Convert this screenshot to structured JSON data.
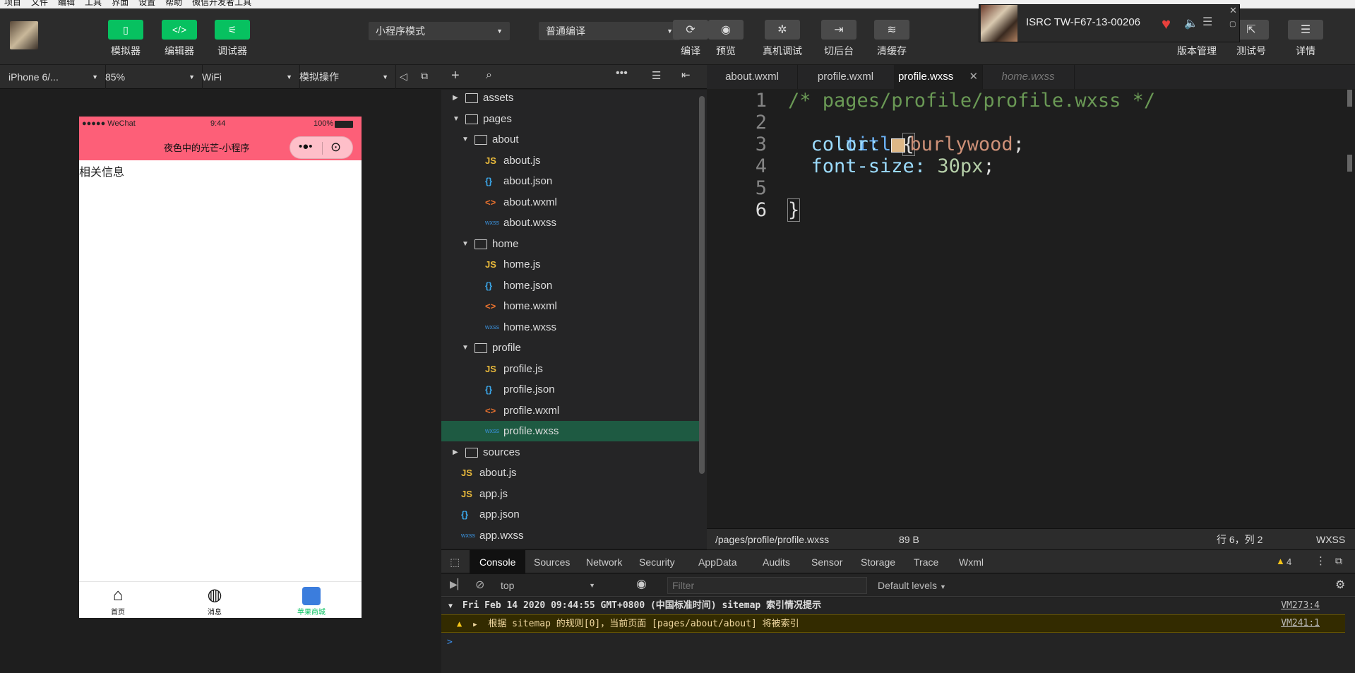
{
  "menubar": [
    "项目",
    "文件",
    "编辑",
    "工具",
    "界面",
    "设置",
    "帮助",
    "微信开发者工具"
  ],
  "toolbar": {
    "simulator": "模拟器",
    "editor": "编辑器",
    "debugger": "调试器",
    "mode_select": "小程序模式",
    "compile_select": "普通编译",
    "compile": "编译",
    "preview": "预览",
    "remote_debug": "真机调试",
    "background": "切后台",
    "clear_cache": "清缓存",
    "version": "版本管理",
    "test_account": "测试号",
    "details": "详情"
  },
  "notification": {
    "title": "ISRC TW-F67-13-00206"
  },
  "devbar": {
    "device": "iPhone 6/...",
    "zoom": "85%",
    "network": "WiFi",
    "operation": "模拟操作"
  },
  "phone": {
    "carrier": "●●●●● WeChat",
    "time": "9:44",
    "battery": "100%",
    "nav_title": "夜色中的光芒-小程序",
    "content": "相关信息",
    "tabs": [
      {
        "label": "首页",
        "icon": "home-icon",
        "color": "#111111"
      },
      {
        "label": "消息",
        "icon": "chat-icon",
        "color": "#111111"
      },
      {
        "label": "苹果商城",
        "icon": "apple-icon",
        "color": "#07c160"
      }
    ],
    "nav_color": "#fd5f78"
  },
  "tree": [
    {
      "type": "folder",
      "name": "assets",
      "depth": 0,
      "open": false
    },
    {
      "type": "folder",
      "name": "pages",
      "depth": 0,
      "open": true
    },
    {
      "type": "folder",
      "name": "about",
      "depth": 1,
      "open": true
    },
    {
      "type": "js",
      "name": "about.js",
      "depth": 2
    },
    {
      "type": "json",
      "name": "about.json",
      "depth": 2
    },
    {
      "type": "wxml",
      "name": "about.wxml",
      "depth": 2
    },
    {
      "type": "wxss",
      "name": "about.wxss",
      "depth": 2
    },
    {
      "type": "folder",
      "name": "home",
      "depth": 1,
      "open": true
    },
    {
      "type": "js",
      "name": "home.js",
      "depth": 2
    },
    {
      "type": "json",
      "name": "home.json",
      "depth": 2
    },
    {
      "type": "wxml",
      "name": "home.wxml",
      "depth": 2
    },
    {
      "type": "wxss",
      "name": "home.wxss",
      "depth": 2
    },
    {
      "type": "folder",
      "name": "profile",
      "depth": 1,
      "open": true
    },
    {
      "type": "js",
      "name": "profile.js",
      "depth": 2
    },
    {
      "type": "json",
      "name": "profile.json",
      "depth": 2
    },
    {
      "type": "wxml",
      "name": "profile.wxml",
      "depth": 2
    },
    {
      "type": "wxss",
      "name": "profile.wxss",
      "depth": 2,
      "selected": true
    },
    {
      "type": "folder",
      "name": "sources",
      "depth": 0,
      "open": false
    },
    {
      "type": "js",
      "name": "about.js",
      "depth": 0
    },
    {
      "type": "js",
      "name": "app.js",
      "depth": 0
    },
    {
      "type": "json",
      "name": "app.json",
      "depth": 0
    },
    {
      "type": "wxss",
      "name": "app.wxss",
      "depth": 0
    }
  ],
  "editor_tabs": [
    {
      "label": "about.wxml",
      "active": false
    },
    {
      "label": "profile.wxml",
      "active": false
    },
    {
      "label": "profile.wxss",
      "active": true
    },
    {
      "label": "home.wxss",
      "active": false,
      "italic": true
    }
  ],
  "code": {
    "line_numbers": [
      "1",
      "2",
      "3",
      "4",
      "5",
      "6"
    ],
    "comment": "/* pages/profile/profile.wxss */",
    "selector": ".title",
    "open_brace": "{",
    "prop1": "color:",
    "val1": "burlywood",
    "swatch": "#deb887",
    "prop2": "font-size:",
    "val2": "30px",
    "semicolon": ";",
    "close_brace": "}"
  },
  "edstatus": {
    "path": "/pages/profile/profile.wxss",
    "size": "89 B",
    "position": "行 6，列 2",
    "lang": "WXSS"
  },
  "devtools": {
    "tabs": [
      "Console",
      "Sources",
      "Network",
      "Security",
      "AppData",
      "Audits",
      "Sensor",
      "Storage",
      "Trace",
      "Wxml"
    ],
    "warn_count": "4",
    "context": "top",
    "filter_placeholder": "Filter",
    "levels": "Default levels",
    "group_title": "Fri Feb 14 2020 09:44:55 GMT+0800 (中国标准时间) sitemap 索引情况提示",
    "group_src": "VM273:4",
    "warn_msg": "根据 sitemap 的规则[0]，当前页面 [pages/about/about] 将被索引",
    "warn_src": "VM241:1",
    "prompt": ">"
  }
}
